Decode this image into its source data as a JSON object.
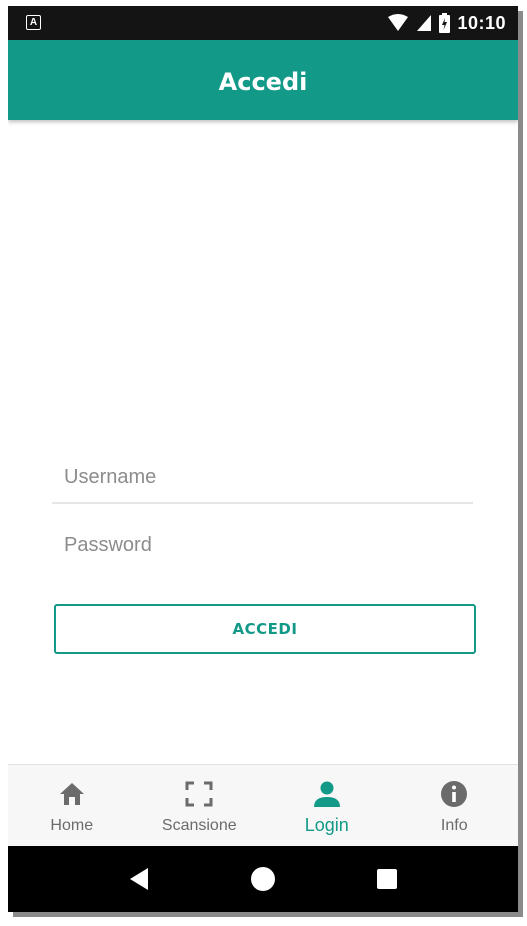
{
  "status_bar": {
    "notification_icon": "a-notification-icon",
    "time": "10:10",
    "icons": [
      "wifi-icon",
      "signal-icon",
      "battery-charging-icon"
    ]
  },
  "app_bar": {
    "title": "Accedi"
  },
  "form": {
    "username_placeholder": "Username",
    "password_placeholder": "Password",
    "submit_label": "ACCEDI"
  },
  "bottom_nav": {
    "items": [
      {
        "label": "Home",
        "icon": "home-icon",
        "active": false
      },
      {
        "label": "Scansione",
        "icon": "scan-frame-icon",
        "active": false
      },
      {
        "label": "Login",
        "icon": "person-icon",
        "active": true
      },
      {
        "label": "Info",
        "icon": "info-icon",
        "active": false
      }
    ]
  },
  "system_nav": {
    "buttons": [
      "back-icon",
      "home-circle-icon",
      "recents-square-icon"
    ]
  },
  "colors": {
    "primary": "#139987",
    "status_bar": "#141414",
    "inactive": "#6b6b6b"
  }
}
